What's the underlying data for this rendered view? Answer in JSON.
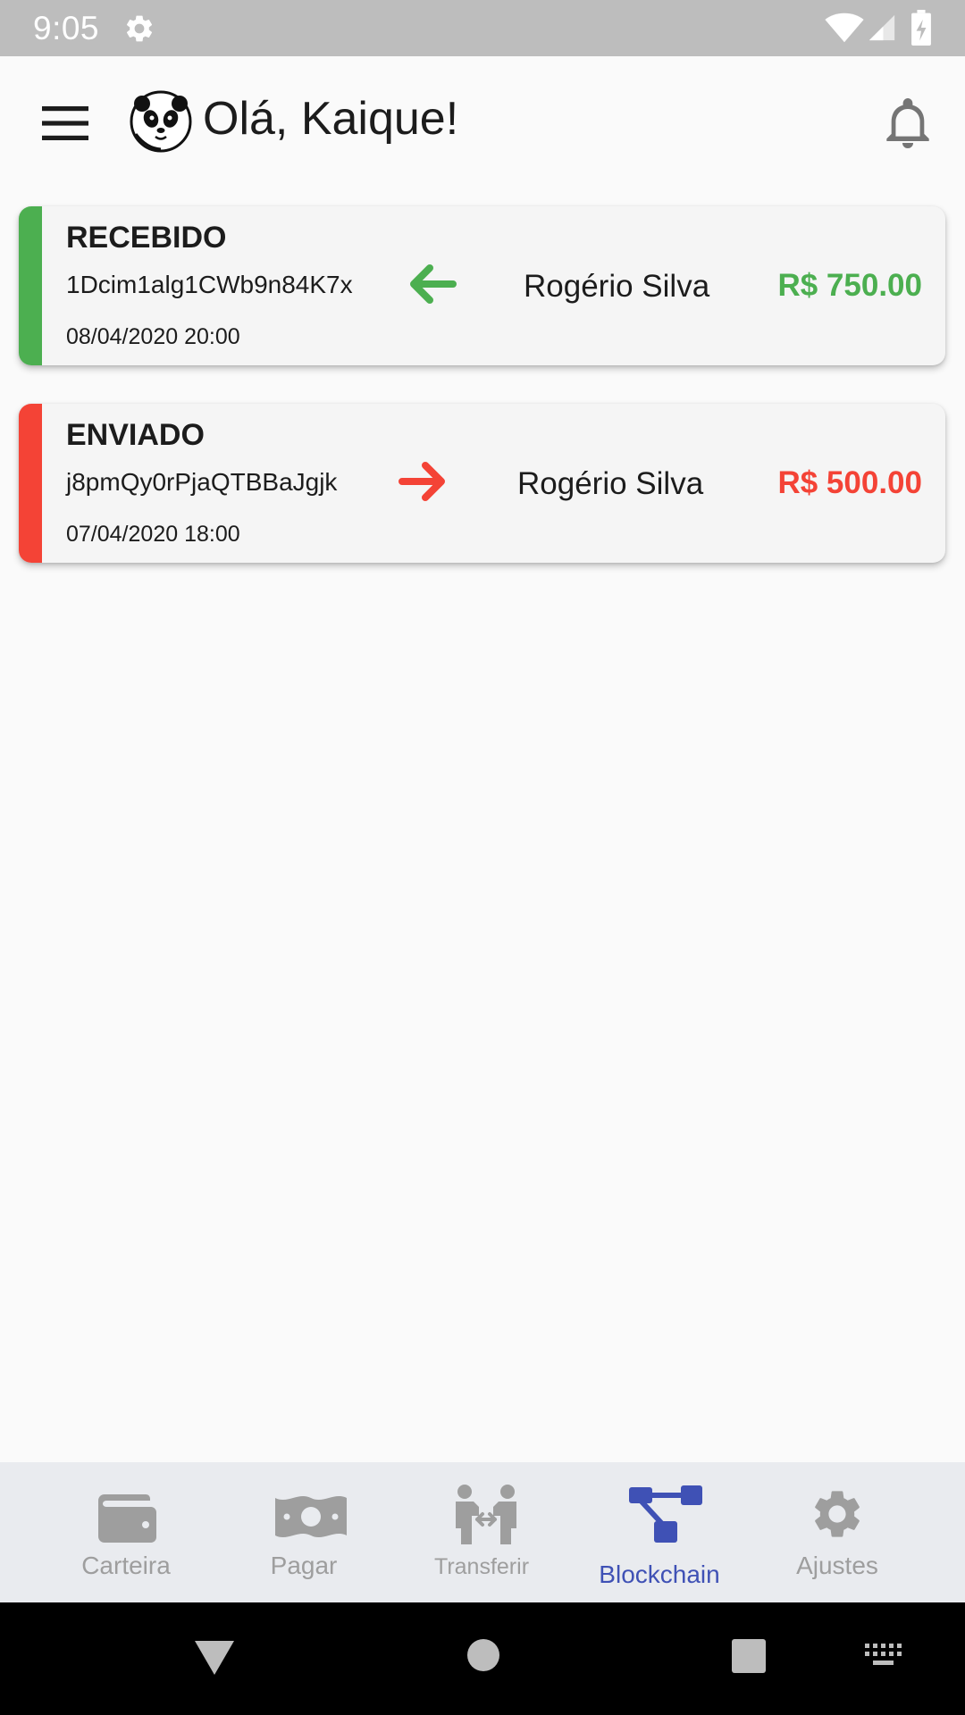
{
  "status_bar": {
    "time": "9:05",
    "icons": [
      "gear-icon",
      "wifi-icon",
      "signal-icon",
      "battery-icon"
    ]
  },
  "header": {
    "greeting": "Olá, Kaique!",
    "icons": [
      "menu-icon",
      "panda-avatar",
      "bell-icon"
    ]
  },
  "colors": {
    "received": "#4caf50",
    "sent": "#f44336",
    "nav_active": "#3f51b5",
    "nav_inactive": "#9e9e9e"
  },
  "transactions": [
    {
      "type": "RECEBIDO",
      "hash": "1Dcim1alg1CWb9n84K7x",
      "date": "08/04/2020 20:00",
      "direction_icon": "arrow-left-icon",
      "name": "Rogério Silva",
      "amount": "R$ 750.00"
    },
    {
      "type": "ENVIADO",
      "hash": "j8pmQy0rPjaQTBBaJgjk",
      "date": "07/04/2020 18:00",
      "direction_icon": "arrow-right-icon",
      "name": "Rogério Silva",
      "amount": "R$ 500.00"
    }
  ],
  "bottom_nav": {
    "items": [
      {
        "label": "Carteira",
        "icon": "wallet-icon",
        "active": false
      },
      {
        "label": "Pagar",
        "icon": "money-icon",
        "active": false
      },
      {
        "label": "Transferir",
        "icon": "transfer-icon",
        "active": false
      },
      {
        "label": "Blockchain",
        "icon": "blockchain-icon",
        "active": true
      },
      {
        "label": "Ajustes",
        "icon": "settings-icon",
        "active": false
      }
    ]
  },
  "system_nav": {
    "icons": [
      "back-icon",
      "home-icon",
      "recents-icon",
      "keyboard-icon"
    ]
  }
}
